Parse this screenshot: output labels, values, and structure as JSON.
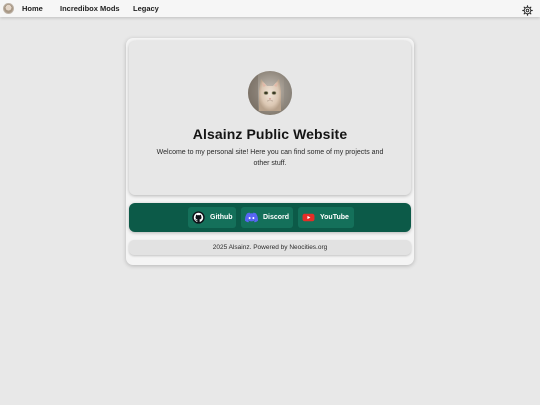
{
  "nav": {
    "items": [
      {
        "label": "Home"
      },
      {
        "label": "Incredibox Mods"
      },
      {
        "label": "Legacy"
      }
    ],
    "settings_icon": "gear-icon"
  },
  "hero": {
    "title": "Alsainz Public Website",
    "description": "Welcome to my personal site! Here you can find some of my projects and other stuff."
  },
  "links": [
    {
      "label": "Github",
      "icon": "github-icon"
    },
    {
      "label": "Discord",
      "icon": "discord-icon"
    },
    {
      "label": "YouTube",
      "icon": "youtube-icon"
    }
  ],
  "footer": {
    "text": "2025 Alsainz. Powered by Neocities.org"
  },
  "colors": {
    "background": "#e8e8e8",
    "card": "#f4f4f4",
    "hero": "#e7e7e7",
    "links_bar": "#0c5a48",
    "link_button": "#14705a",
    "youtube_red": "#e52d27",
    "discord_blue": "#5865f2"
  }
}
